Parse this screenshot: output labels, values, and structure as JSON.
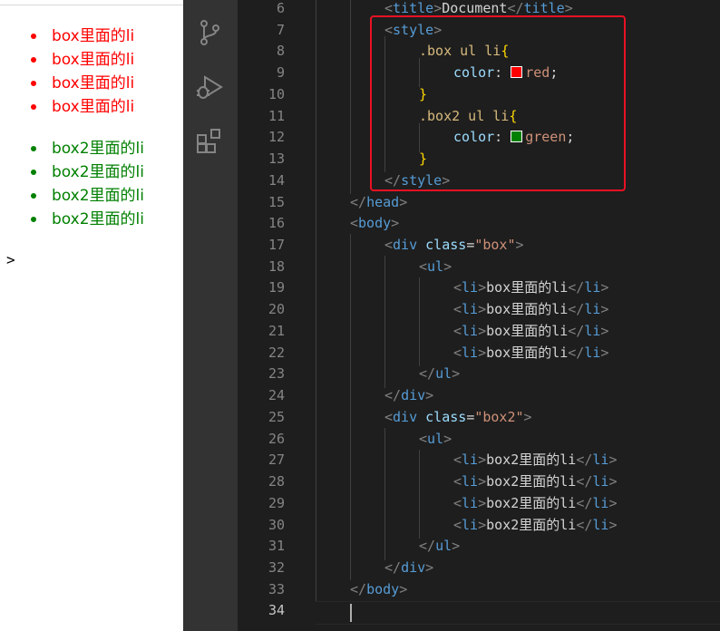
{
  "preview": {
    "box_items": [
      "box里面的li",
      "box里面的li",
      "box里面的li",
      "box里面的li"
    ],
    "box2_items": [
      "box2里面的li",
      "box2里面的li",
      "box2里面的li",
      "box2里面的li"
    ],
    "caret": ">",
    "box_color": "#ff0000",
    "box2_color": "#008000"
  },
  "activity_bar": {
    "icons": [
      "source-control-icon",
      "run-debug-icon",
      "extensions-icon"
    ]
  },
  "editor": {
    "active_line": "34",
    "lines": [
      {
        "n": "6",
        "t": [
          [
            "br",
            "<"
          ],
          [
            "tag",
            "title"
          ],
          [
            "br",
            ">"
          ],
          [
            "txt",
            "Document"
          ],
          [
            "br",
            "</"
          ],
          [
            "tag",
            "title"
          ],
          [
            "br",
            ">"
          ]
        ]
      },
      {
        "n": "7",
        "t": [
          [
            "br",
            "<"
          ],
          [
            "tag",
            "style"
          ],
          [
            "br",
            ">"
          ]
        ]
      },
      {
        "n": "8",
        "t": [
          [
            "sel",
            ".box ul li"
          ],
          [
            "brace",
            "{"
          ]
        ]
      },
      {
        "n": "9",
        "t": [
          [
            "prop",
            "color"
          ],
          [
            "txt",
            ": "
          ],
          [
            "swatch",
            "#ff0000"
          ],
          [
            "str",
            "red"
          ],
          [
            "txt",
            ";"
          ]
        ]
      },
      {
        "n": "10",
        "t": [
          [
            "brace",
            "}"
          ]
        ]
      },
      {
        "n": "11",
        "t": [
          [
            "sel",
            ".box2 ul li"
          ],
          [
            "brace",
            "{"
          ]
        ]
      },
      {
        "n": "12",
        "t": [
          [
            "prop",
            "color"
          ],
          [
            "txt",
            ": "
          ],
          [
            "swatch",
            "#008000"
          ],
          [
            "str",
            "green"
          ],
          [
            "txt",
            ";"
          ]
        ]
      },
      {
        "n": "13",
        "t": [
          [
            "brace",
            "}"
          ]
        ]
      },
      {
        "n": "14",
        "t": [
          [
            "br",
            "</"
          ],
          [
            "tag",
            "style"
          ],
          [
            "br",
            ">"
          ]
        ]
      },
      {
        "n": "15",
        "t": [
          [
            "br",
            "</"
          ],
          [
            "tag",
            "head"
          ],
          [
            "br",
            ">"
          ]
        ]
      },
      {
        "n": "16",
        "t": [
          [
            "br",
            "<"
          ],
          [
            "tag",
            "body"
          ],
          [
            "br",
            ">"
          ]
        ]
      },
      {
        "n": "17",
        "t": [
          [
            "br",
            "<"
          ],
          [
            "tag",
            "div"
          ],
          [
            "txt",
            " "
          ],
          [
            "attr",
            "class"
          ],
          [
            "txt",
            "="
          ],
          [
            "str",
            "\"box\""
          ],
          [
            "br",
            ">"
          ]
        ]
      },
      {
        "n": "18",
        "t": [
          [
            "br",
            "<"
          ],
          [
            "tag",
            "ul"
          ],
          [
            "br",
            ">"
          ]
        ]
      },
      {
        "n": "19",
        "t": [
          [
            "br",
            "<"
          ],
          [
            "tag",
            "li"
          ],
          [
            "br",
            ">"
          ],
          [
            "txt",
            "box里面的li"
          ],
          [
            "br",
            "</"
          ],
          [
            "tag",
            "li"
          ],
          [
            "br",
            ">"
          ]
        ]
      },
      {
        "n": "20",
        "t": [
          [
            "br",
            "<"
          ],
          [
            "tag",
            "li"
          ],
          [
            "br",
            ">"
          ],
          [
            "txt",
            "box里面的li"
          ],
          [
            "br",
            "</"
          ],
          [
            "tag",
            "li"
          ],
          [
            "br",
            ">"
          ]
        ]
      },
      {
        "n": "21",
        "t": [
          [
            "br",
            "<"
          ],
          [
            "tag",
            "li"
          ],
          [
            "br",
            ">"
          ],
          [
            "txt",
            "box里面的li"
          ],
          [
            "br",
            "</"
          ],
          [
            "tag",
            "li"
          ],
          [
            "br",
            ">"
          ]
        ]
      },
      {
        "n": "22",
        "t": [
          [
            "br",
            "<"
          ],
          [
            "tag",
            "li"
          ],
          [
            "br",
            ">"
          ],
          [
            "txt",
            "box里面的li"
          ],
          [
            "br",
            "</"
          ],
          [
            "tag",
            "li"
          ],
          [
            "br",
            ">"
          ]
        ]
      },
      {
        "n": "23",
        "t": [
          [
            "br",
            "</"
          ],
          [
            "tag",
            "ul"
          ],
          [
            "br",
            ">"
          ]
        ]
      },
      {
        "n": "24",
        "t": [
          [
            "br",
            "</"
          ],
          [
            "tag",
            "div"
          ],
          [
            "br",
            ">"
          ]
        ]
      },
      {
        "n": "25",
        "t": [
          [
            "br",
            "<"
          ],
          [
            "tag",
            "div"
          ],
          [
            "txt",
            " "
          ],
          [
            "attr",
            "class"
          ],
          [
            "txt",
            "="
          ],
          [
            "str",
            "\"box2\""
          ],
          [
            "br",
            ">"
          ]
        ]
      },
      {
        "n": "26",
        "t": [
          [
            "br",
            "<"
          ],
          [
            "tag",
            "ul"
          ],
          [
            "br",
            ">"
          ]
        ]
      },
      {
        "n": "27",
        "t": [
          [
            "br",
            "<"
          ],
          [
            "tag",
            "li"
          ],
          [
            "br",
            ">"
          ],
          [
            "txt",
            "box2里面的li"
          ],
          [
            "br",
            "</"
          ],
          [
            "tag",
            "li"
          ],
          [
            "br",
            ">"
          ]
        ]
      },
      {
        "n": "28",
        "t": [
          [
            "br",
            "<"
          ],
          [
            "tag",
            "li"
          ],
          [
            "br",
            ">"
          ],
          [
            "txt",
            "box2里面的li"
          ],
          [
            "br",
            "</"
          ],
          [
            "tag",
            "li"
          ],
          [
            "br",
            ">"
          ]
        ]
      },
      {
        "n": "29",
        "t": [
          [
            "br",
            "<"
          ],
          [
            "tag",
            "li"
          ],
          [
            "br",
            ">"
          ],
          [
            "txt",
            "box2里面的li"
          ],
          [
            "br",
            "</"
          ],
          [
            "tag",
            "li"
          ],
          [
            "br",
            ">"
          ]
        ]
      },
      {
        "n": "30",
        "t": [
          [
            "br",
            "<"
          ],
          [
            "tag",
            "li"
          ],
          [
            "br",
            ">"
          ],
          [
            "txt",
            "box2里面的li"
          ],
          [
            "br",
            "</"
          ],
          [
            "tag",
            "li"
          ],
          [
            "br",
            ">"
          ]
        ]
      },
      {
        "n": "31",
        "t": [
          [
            "br",
            "</"
          ],
          [
            "tag",
            "ul"
          ],
          [
            "br",
            ">"
          ]
        ]
      },
      {
        "n": "32",
        "t": [
          [
            "br",
            "</"
          ],
          [
            "tag",
            "div"
          ],
          [
            "br",
            ">"
          ]
        ]
      },
      {
        "n": "33",
        "t": [
          [
            "br",
            "</"
          ],
          [
            "tag",
            "body"
          ],
          [
            "br",
            ">"
          ]
        ]
      },
      {
        "n": "34",
        "t": []
      }
    ]
  }
}
